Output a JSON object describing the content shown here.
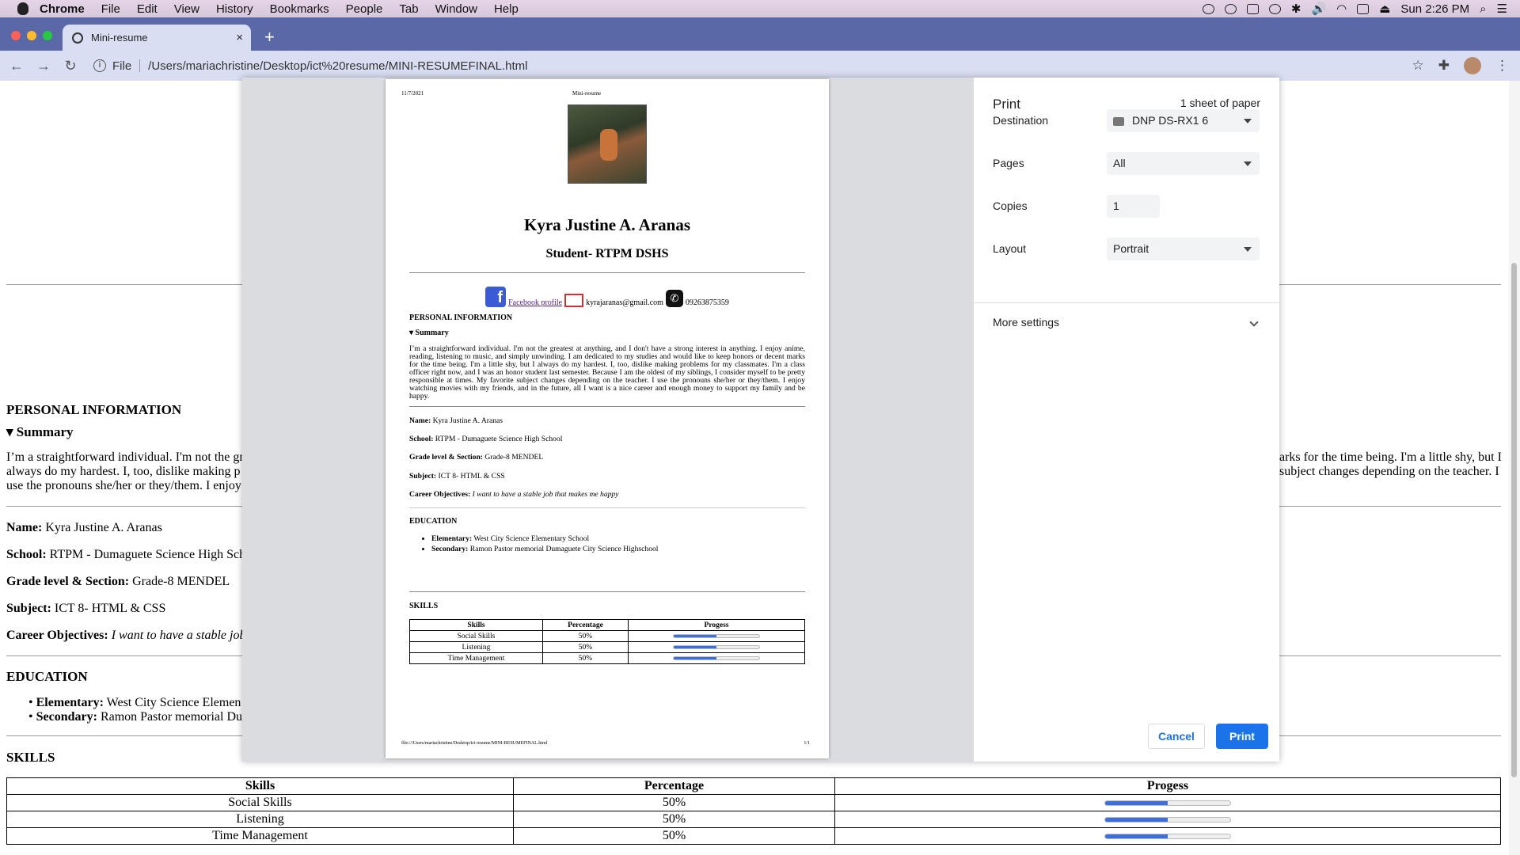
{
  "menubar": {
    "app": "Chrome",
    "items": [
      "File",
      "Edit",
      "View",
      "History",
      "Bookmarks",
      "People",
      "Tab",
      "Window",
      "Help"
    ],
    "clock": "Sun 2:26 PM"
  },
  "tab": {
    "title": "Mini-resume",
    "close": "×",
    "new": "+"
  },
  "toolbar": {
    "scheme": "File",
    "url": "/Users/mariachristine/Desktop/ict%20resume/MINI-RESUMEFINAL.html"
  },
  "page": {
    "personal_heading": "PERSONAL INFORMATION",
    "summary_heading": "▾ Summary",
    "summary_lines": [
      "I’m a straightforward individual. I'm not the gr",
      "always do my hardest. I, too, dislike making p",
      "use the pronouns she/her or they/them. I enjoy"
    ],
    "summary_right_lines": [
      "arks for the time being. I'm a little shy, but I",
      "subject changes depending on the teacher. I"
    ],
    "name_label": "Name:",
    "name": "Kyra Justine A. Aranas",
    "school_label": "School:",
    "school": "RTPM - Dumaguete Science High Sch",
    "grade_label": "Grade level & Section:",
    "grade": "Grade-8 MENDEL",
    "subject_label": "Subject:",
    "subject": "ICT 8- HTML & CSS",
    "career_label": "Career Objectives:",
    "career": "I want to have a stable job",
    "education_heading": "EDUCATION",
    "elem_label": "Elementary:",
    "elem": "West City Science Elemen",
    "sec_label": "Secondary:",
    "sec": "Ramon Pastor memorial Du",
    "skills_heading": "SKILLS",
    "table_headers": [
      "Skills",
      "Percentage",
      "Progess"
    ],
    "table_rows": [
      [
        "Social Skills",
        "50%"
      ],
      [
        "Listening",
        "50%"
      ],
      [
        "Time Management",
        "50%"
      ]
    ],
    "progress_values": [
      0.5,
      0.5,
      0.5
    ]
  },
  "preview": {
    "date": "11/7/2021",
    "doc_title": "Mini-resume",
    "name": "Kyra Justine A. Aranas",
    "role": "Student- RTPM DSHS",
    "fb_link": "Facebook profile",
    "email": "kyrajaranas@gmail.com",
    "phone": "09263875359",
    "personal_heading": "PERSONAL INFORMATION",
    "summary_heading": "▾ Summary",
    "summary": "I’m a straightforward individual. I'm not the greatest at anything, and I don't have a strong interest in anything. I enjoy anime, reading, listening to music, and simply unwinding. I am dedicated to my studies and would like to keep honors or decent marks for the time being. I'm a little shy, but I always do my hardest. I, too, dislike making problems for my classmates. I'm a class officer right now, and I was an honor student last semester. Because I am the oldest of my siblings, I consider myself to be pretty responsible at times. My favorite subject changes depending on the teacher. I use the pronouns she/her or they/them. I enjoy watching movies with my friends, and in the future, all I want is a nice career and enough money to support my family and be happy.",
    "name_label": "Name:",
    "name_val": "Kyra Justine A. Aranas",
    "school_label": "School:",
    "school": "RTPM - Dumaguete Science High School",
    "grade_label": "Grade level & Section:",
    "grade": "Grade-8 MENDEL",
    "subject_label": "Subject:",
    "subject": "ICT 8- HTML & CSS",
    "career_label": "Career Objectives:",
    "career": "I want to have a stable job that makes me happy",
    "education_heading": "EDUCATION",
    "elem_label": "Elementary:",
    "elem": "West City Science Elementary School",
    "sec_label": "Secondary:",
    "sec": "Ramon Pastor memorial Dumaguete City Science Highschool",
    "skills_heading": "SKILLS",
    "footer_path": "file:///Users/mariachristine/Desktop/ict resume/MINI-RESUMEFINAL.html",
    "footer_page": "1/1"
  },
  "print_panel": {
    "title": "Print",
    "sheets": "1 sheet of paper",
    "destination_label": "Destination",
    "destination": "DNP DS-RX1 6",
    "pages_label": "Pages",
    "pages": "All",
    "copies_label": "Copies",
    "copies": "1",
    "layout_label": "Layout",
    "layout": "Portrait",
    "more_settings": "More settings",
    "cancel": "Cancel",
    "print": "Print"
  },
  "colors": {
    "accent": "#1a73e8",
    "progress": "#3b6fe0",
    "tabstrip": "#5a68a8"
  }
}
